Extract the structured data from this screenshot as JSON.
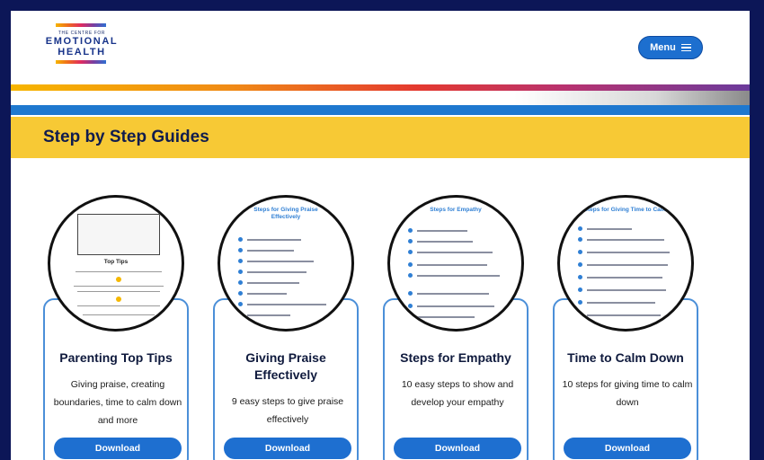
{
  "logo": {
    "small_text": "THE CENTRE FOR",
    "line1": "EMOTIONAL",
    "line2": "HEALTH"
  },
  "header": {
    "menu_label": "Menu"
  },
  "section": {
    "title": "Step by Step Guides"
  },
  "cards": [
    {
      "title": "Parenting Top Tips",
      "description": "Giving praise, creating boundaries, time to calm down and more",
      "button_label": "Download",
      "thumb_title": "Top Tips"
    },
    {
      "title": "Giving Praise Effectively",
      "description": "9 easy steps to give praise effectively",
      "button_label": "Download",
      "thumb_title": "Steps for Giving Praise Effectively"
    },
    {
      "title": "Steps for Empathy",
      "description": "10 easy steps to show and develop your empathy",
      "button_label": "Download",
      "thumb_title": "Steps for Empathy"
    },
    {
      "title": "Time to Calm Down",
      "description": "10 steps for giving time to calm down",
      "button_label": "Download",
      "thumb_title": "Steps for Giving Time to Calm"
    }
  ],
  "colors": {
    "frame": "#0c1657",
    "accent_blue": "#1e6fd0",
    "banner_yellow": "#f7c935",
    "card_border": "#4b8fd8"
  },
  "icons": {
    "menu": "hamburger-icon"
  }
}
